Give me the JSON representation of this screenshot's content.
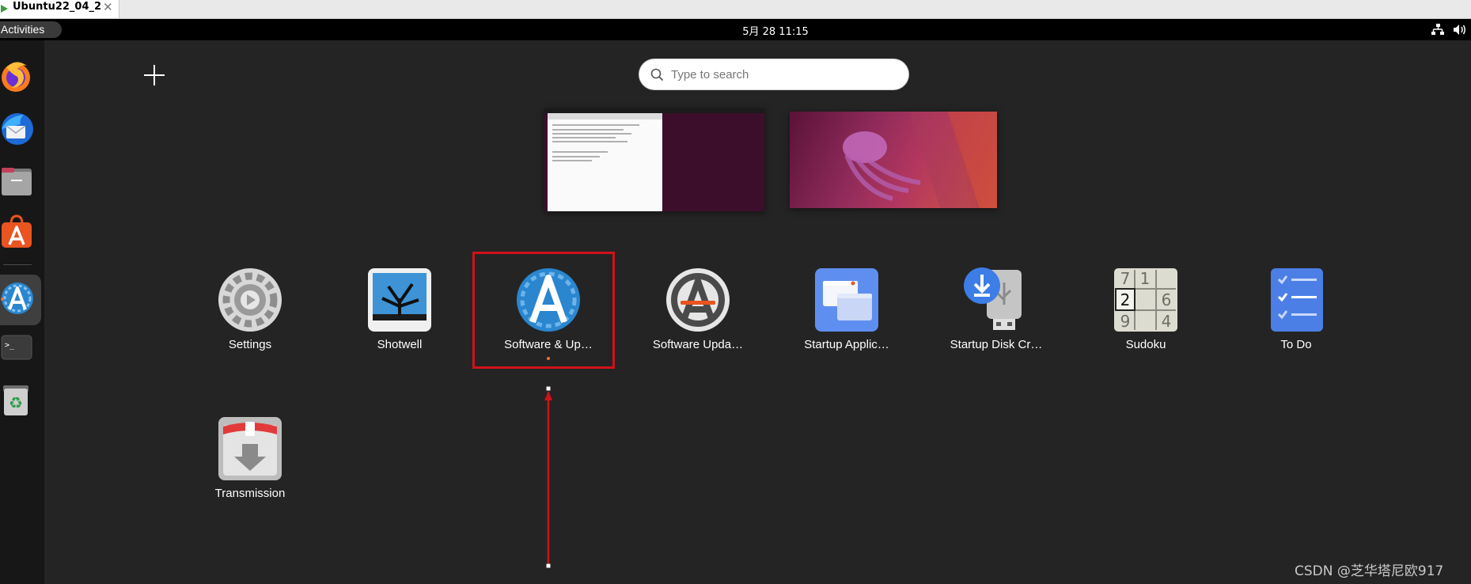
{
  "vm_tab": {
    "title": "Ubuntu22_04_2",
    "close": "✕"
  },
  "topbar": {
    "activities": "Activities",
    "clock": "5月 28  11:15"
  },
  "search": {
    "placeholder": "Type to search",
    "value": ""
  },
  "dock": {
    "items": [
      {
        "name": "firefox",
        "icon": "firefox-icon"
      },
      {
        "name": "thunderbird",
        "icon": "thunderbird-icon"
      },
      {
        "name": "files",
        "icon": "files-icon"
      },
      {
        "name": "app-center",
        "icon": "app-center-icon"
      },
      {
        "name": "software-updates",
        "icon": "software-updates-icon",
        "active": true
      },
      {
        "name": "terminal",
        "icon": "terminal-icon",
        "glyph": ">_"
      },
      {
        "name": "trash",
        "icon": "trash-icon",
        "glyph": "♻"
      }
    ]
  },
  "apps": [
    {
      "label": "Settings",
      "icon": "settings-icon"
    },
    {
      "label": "Shotwell",
      "icon": "shotwell-icon"
    },
    {
      "label": "Software & Up…",
      "icon": "software-updates-icon",
      "running": true,
      "highlighted": true
    },
    {
      "label": "Software Upda…",
      "icon": "software-updater-icon"
    },
    {
      "label": "Startup Applic…",
      "icon": "startup-applications-icon"
    },
    {
      "label": "Startup Disk Cr…",
      "icon": "startup-disk-creator-icon"
    },
    {
      "label": "Sudoku",
      "icon": "sudoku-icon",
      "digits": [
        "7",
        "1",
        "2",
        "6",
        "9",
        "4"
      ]
    },
    {
      "label": "To Do",
      "icon": "todo-icon"
    },
    {
      "label": "Transmission",
      "icon": "transmission-icon"
    }
  ],
  "watermark": "CSDN @芝华塔尼欧917",
  "colors": {
    "accent": "#e8733a",
    "annotation": "#d0121b",
    "background": "#242424",
    "dock": "#171717"
  }
}
